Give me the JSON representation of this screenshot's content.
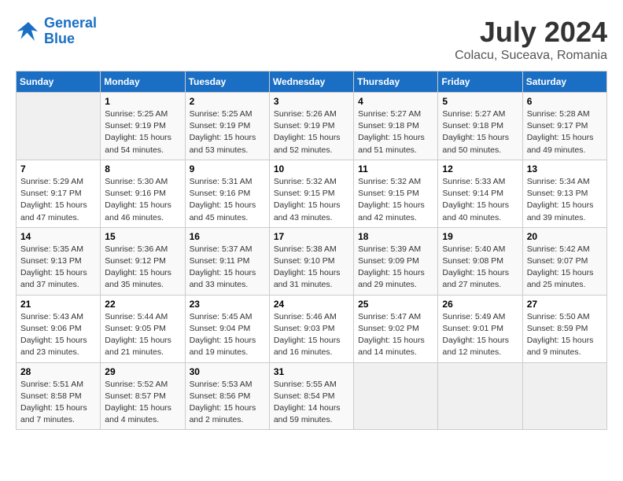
{
  "header": {
    "logo_line1": "General",
    "logo_line2": "Blue",
    "month_title": "July 2024",
    "location": "Colacu, Suceava, Romania"
  },
  "weekdays": [
    "Sunday",
    "Monday",
    "Tuesday",
    "Wednesday",
    "Thursday",
    "Friday",
    "Saturday"
  ],
  "weeks": [
    [
      {
        "day": "",
        "info": ""
      },
      {
        "day": "1",
        "info": "Sunrise: 5:25 AM\nSunset: 9:19 PM\nDaylight: 15 hours\nand 54 minutes."
      },
      {
        "day": "2",
        "info": "Sunrise: 5:25 AM\nSunset: 9:19 PM\nDaylight: 15 hours\nand 53 minutes."
      },
      {
        "day": "3",
        "info": "Sunrise: 5:26 AM\nSunset: 9:19 PM\nDaylight: 15 hours\nand 52 minutes."
      },
      {
        "day": "4",
        "info": "Sunrise: 5:27 AM\nSunset: 9:18 PM\nDaylight: 15 hours\nand 51 minutes."
      },
      {
        "day": "5",
        "info": "Sunrise: 5:27 AM\nSunset: 9:18 PM\nDaylight: 15 hours\nand 50 minutes."
      },
      {
        "day": "6",
        "info": "Sunrise: 5:28 AM\nSunset: 9:17 PM\nDaylight: 15 hours\nand 49 minutes."
      }
    ],
    [
      {
        "day": "7",
        "info": "Sunrise: 5:29 AM\nSunset: 9:17 PM\nDaylight: 15 hours\nand 47 minutes."
      },
      {
        "day": "8",
        "info": "Sunrise: 5:30 AM\nSunset: 9:16 PM\nDaylight: 15 hours\nand 46 minutes."
      },
      {
        "day": "9",
        "info": "Sunrise: 5:31 AM\nSunset: 9:16 PM\nDaylight: 15 hours\nand 45 minutes."
      },
      {
        "day": "10",
        "info": "Sunrise: 5:32 AM\nSunset: 9:15 PM\nDaylight: 15 hours\nand 43 minutes."
      },
      {
        "day": "11",
        "info": "Sunrise: 5:32 AM\nSunset: 9:15 PM\nDaylight: 15 hours\nand 42 minutes."
      },
      {
        "day": "12",
        "info": "Sunrise: 5:33 AM\nSunset: 9:14 PM\nDaylight: 15 hours\nand 40 minutes."
      },
      {
        "day": "13",
        "info": "Sunrise: 5:34 AM\nSunset: 9:13 PM\nDaylight: 15 hours\nand 39 minutes."
      }
    ],
    [
      {
        "day": "14",
        "info": "Sunrise: 5:35 AM\nSunset: 9:13 PM\nDaylight: 15 hours\nand 37 minutes."
      },
      {
        "day": "15",
        "info": "Sunrise: 5:36 AM\nSunset: 9:12 PM\nDaylight: 15 hours\nand 35 minutes."
      },
      {
        "day": "16",
        "info": "Sunrise: 5:37 AM\nSunset: 9:11 PM\nDaylight: 15 hours\nand 33 minutes."
      },
      {
        "day": "17",
        "info": "Sunrise: 5:38 AM\nSunset: 9:10 PM\nDaylight: 15 hours\nand 31 minutes."
      },
      {
        "day": "18",
        "info": "Sunrise: 5:39 AM\nSunset: 9:09 PM\nDaylight: 15 hours\nand 29 minutes."
      },
      {
        "day": "19",
        "info": "Sunrise: 5:40 AM\nSunset: 9:08 PM\nDaylight: 15 hours\nand 27 minutes."
      },
      {
        "day": "20",
        "info": "Sunrise: 5:42 AM\nSunset: 9:07 PM\nDaylight: 15 hours\nand 25 minutes."
      }
    ],
    [
      {
        "day": "21",
        "info": "Sunrise: 5:43 AM\nSunset: 9:06 PM\nDaylight: 15 hours\nand 23 minutes."
      },
      {
        "day": "22",
        "info": "Sunrise: 5:44 AM\nSunset: 9:05 PM\nDaylight: 15 hours\nand 21 minutes."
      },
      {
        "day": "23",
        "info": "Sunrise: 5:45 AM\nSunset: 9:04 PM\nDaylight: 15 hours\nand 19 minutes."
      },
      {
        "day": "24",
        "info": "Sunrise: 5:46 AM\nSunset: 9:03 PM\nDaylight: 15 hours\nand 16 minutes."
      },
      {
        "day": "25",
        "info": "Sunrise: 5:47 AM\nSunset: 9:02 PM\nDaylight: 15 hours\nand 14 minutes."
      },
      {
        "day": "26",
        "info": "Sunrise: 5:49 AM\nSunset: 9:01 PM\nDaylight: 15 hours\nand 12 minutes."
      },
      {
        "day": "27",
        "info": "Sunrise: 5:50 AM\nSunset: 8:59 PM\nDaylight: 15 hours\nand 9 minutes."
      }
    ],
    [
      {
        "day": "28",
        "info": "Sunrise: 5:51 AM\nSunset: 8:58 PM\nDaylight: 15 hours\nand 7 minutes."
      },
      {
        "day": "29",
        "info": "Sunrise: 5:52 AM\nSunset: 8:57 PM\nDaylight: 15 hours\nand 4 minutes."
      },
      {
        "day": "30",
        "info": "Sunrise: 5:53 AM\nSunset: 8:56 PM\nDaylight: 15 hours\nand 2 minutes."
      },
      {
        "day": "31",
        "info": "Sunrise: 5:55 AM\nSunset: 8:54 PM\nDaylight: 14 hours\nand 59 minutes."
      },
      {
        "day": "",
        "info": ""
      },
      {
        "day": "",
        "info": ""
      },
      {
        "day": "",
        "info": ""
      }
    ]
  ]
}
